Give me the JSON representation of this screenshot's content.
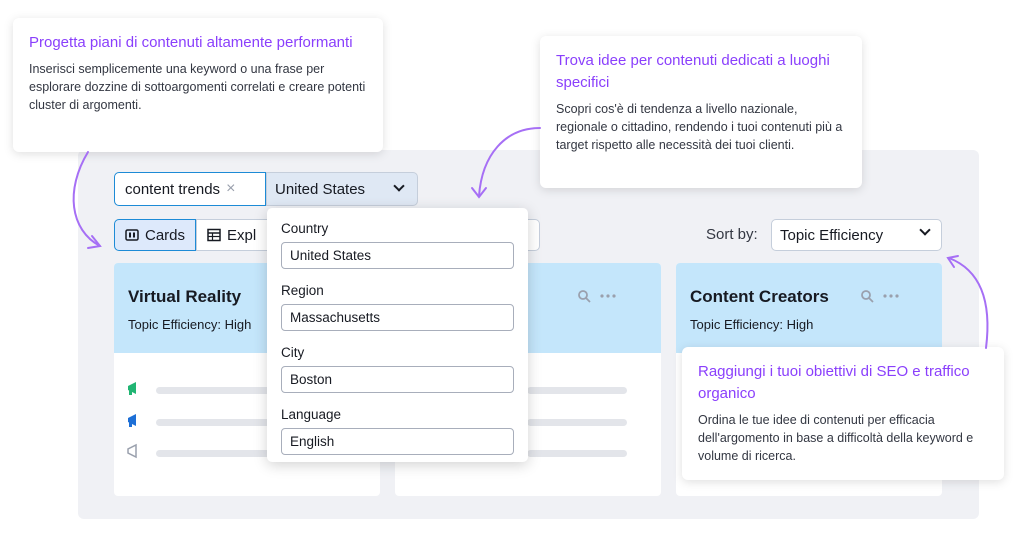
{
  "callouts": [
    {
      "title": "Progetta piani di contenuti altamente performanti",
      "body": "Inserisci semplicemente una keyword o una frase per esplorare dozzine di sottoargomenti correlati e creare potenti cluster di argomenti."
    },
    {
      "title": "Trova idee per contenuti dedicati a luoghi specifici",
      "body": "Scopri cos'è di tendenza a livello nazionale, regionale o cittadino, rendendo i tuoi contenuti più a target rispetto alle necessità dei tuoi clienti."
    },
    {
      "title": "Raggiungi i tuoi obiettivi di SEO e traffico organico",
      "body": "Ordina le tue idee di contenuti per efficacia dell'argomento in base a difficoltà della keyword e volume di ricerca."
    }
  ],
  "search": {
    "value": "content trends",
    "clear_icon": "×"
  },
  "country_select": {
    "value": "United States"
  },
  "view_toggle": {
    "cards_label": "Cards",
    "explorer_label": "Expl"
  },
  "sort": {
    "label": "Sort by:",
    "value": "Topic Efficiency"
  },
  "cards": [
    {
      "title": "Virtual Reality",
      "efficiency": "Topic Efficiency: High"
    },
    {
      "title": "",
      "efficiency": ""
    },
    {
      "title": "Content Creators",
      "efficiency": "Topic Efficiency: High"
    }
  ],
  "location_dropdown": {
    "country_label": "Country",
    "country_value": "United States",
    "region_label": "Region",
    "region_value": "Massachusetts",
    "city_label": "City",
    "city_value": "Boston",
    "language_label": "Language",
    "language_value": "English"
  },
  "colors": {
    "accent": "#8a3ffc",
    "card_header": "#c4e6fb",
    "active_toggle": "#dde9fb",
    "megaphone_green": "#21b573",
    "megaphone_blue": "#1d6fd6"
  }
}
